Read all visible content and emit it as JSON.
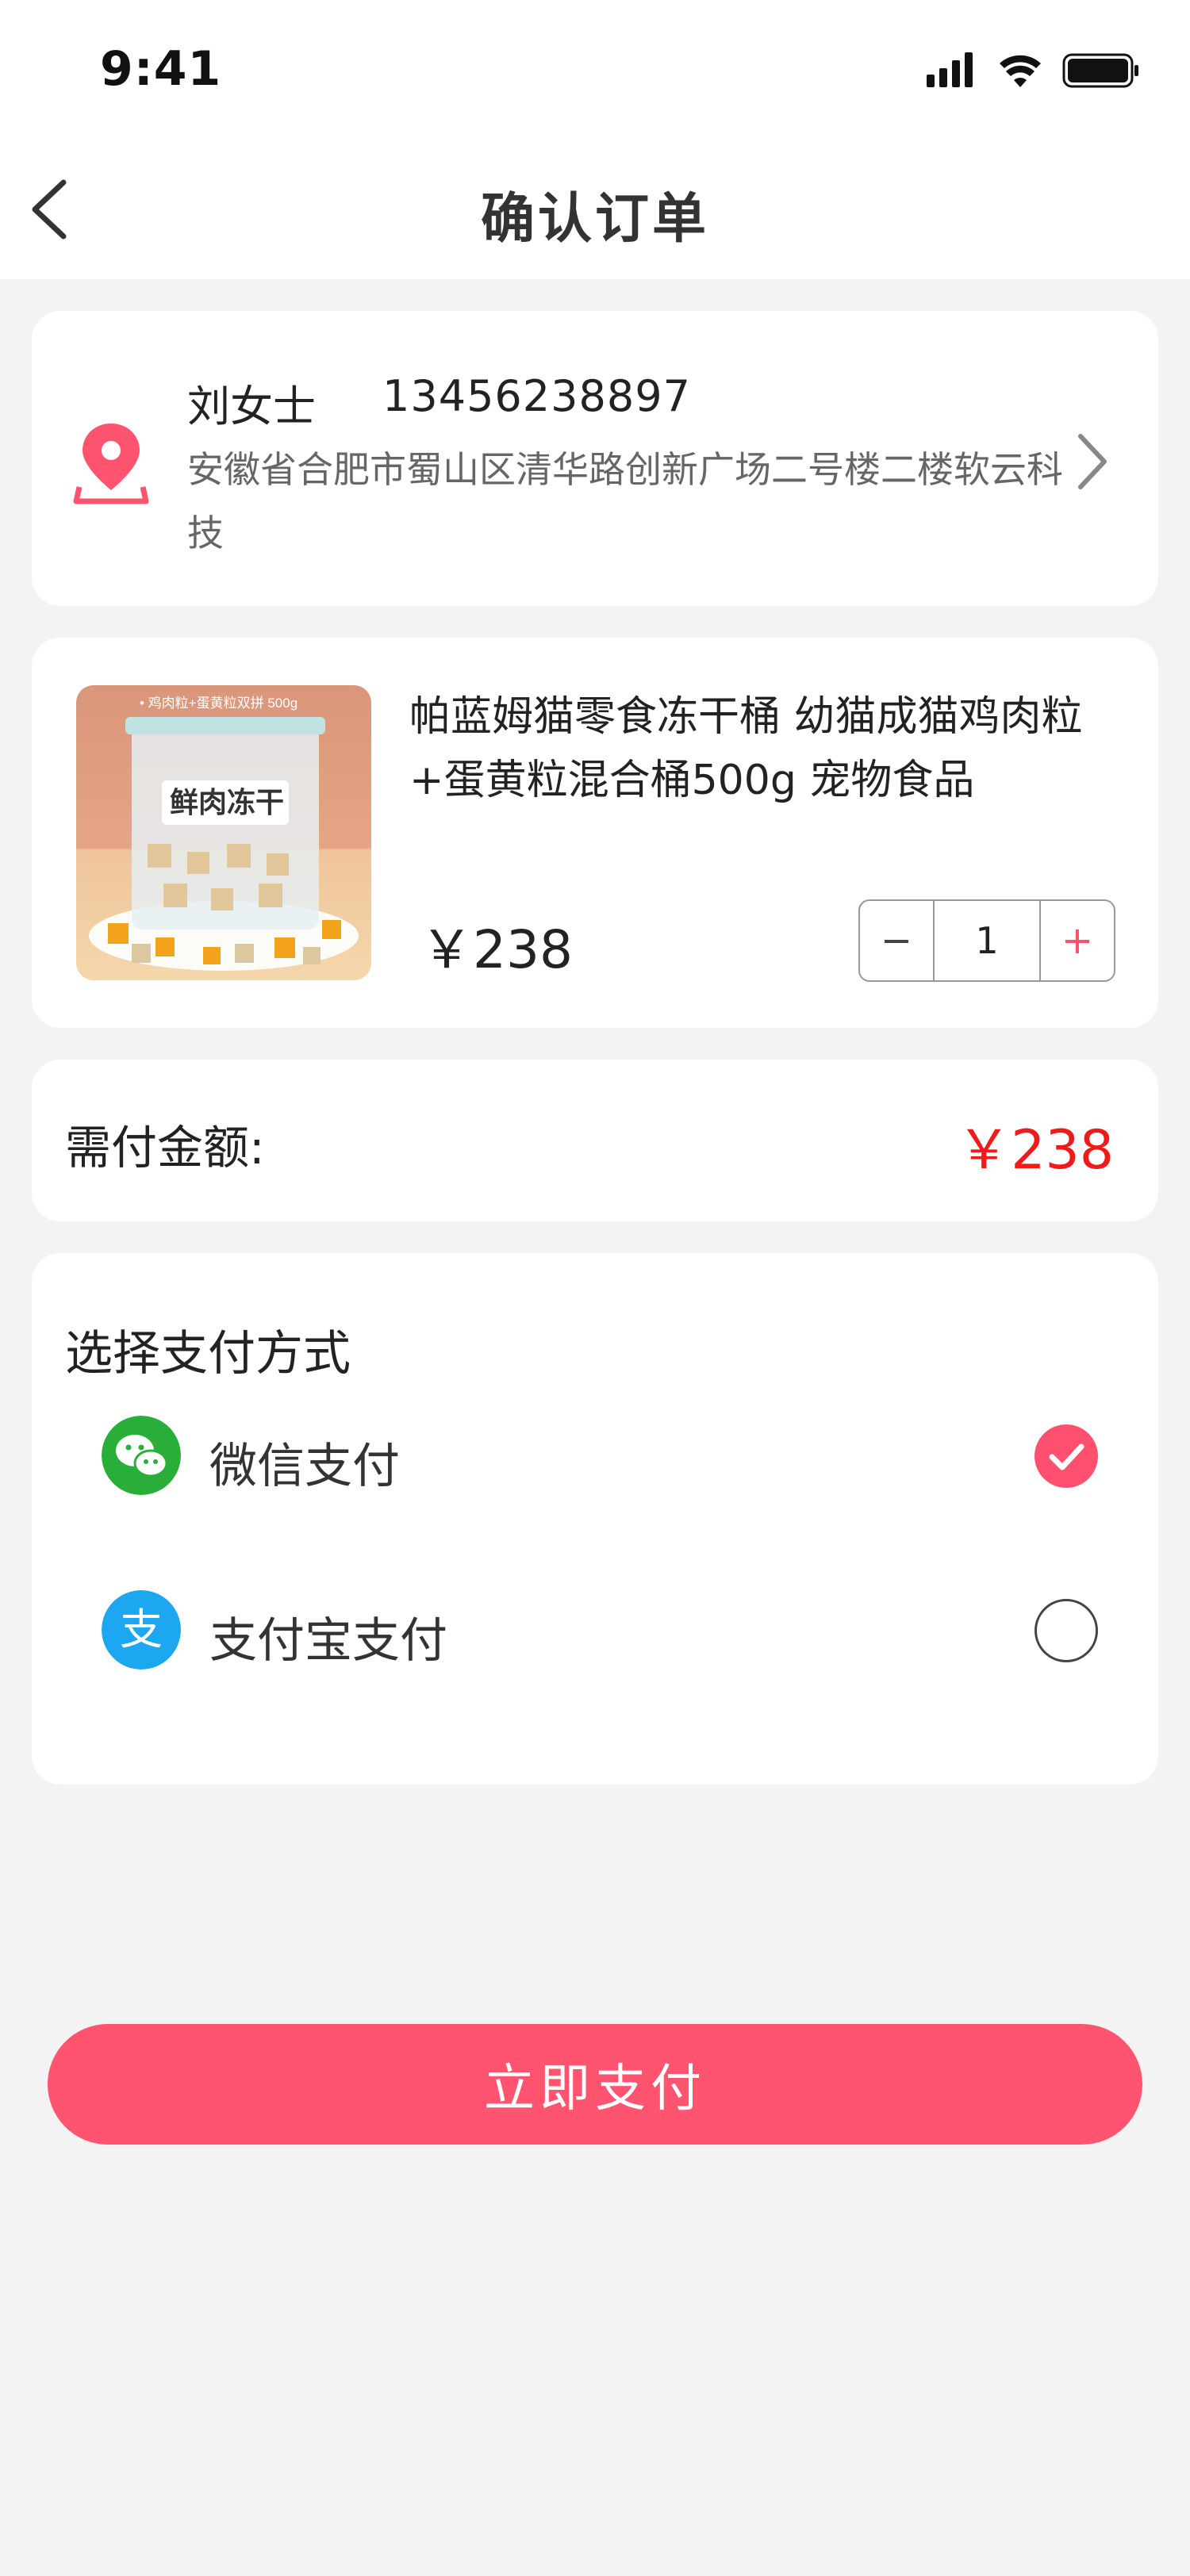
{
  "status_bar": {
    "time": "9:41"
  },
  "nav": {
    "title": "确认订单"
  },
  "address": {
    "name": "刘女士",
    "phone": "13456238897",
    "detail": "安徽省合肥市蜀山区清华路创新广场二号楼二楼软云科技"
  },
  "product": {
    "title": "帕蓝姆猫零食冻干桶 幼猫成猫鸡肉粒+蛋黄粒混合桶500g 宠物食品",
    "price": "￥238",
    "image_tagline": "• 鸡肉粒+蛋黄粒双拼 500g",
    "image_label": "鲜肉冻干",
    "quantity": "1",
    "minus": "−",
    "plus": "+"
  },
  "amount": {
    "label": "需付金额:",
    "value": "￥238"
  },
  "payment": {
    "title": "选择支付方式",
    "options": [
      {
        "label": "微信支付",
        "icon": "wechat-icon",
        "selected": true
      },
      {
        "label": "支付宝支付",
        "icon": "alipay-icon",
        "selected": false
      }
    ]
  },
  "submit": {
    "label": "立即支付"
  },
  "colors": {
    "accent": "#ff5470",
    "price_red": "#f01a1a",
    "wechat": "#2aae3a",
    "alipay": "#1ca7f0"
  }
}
